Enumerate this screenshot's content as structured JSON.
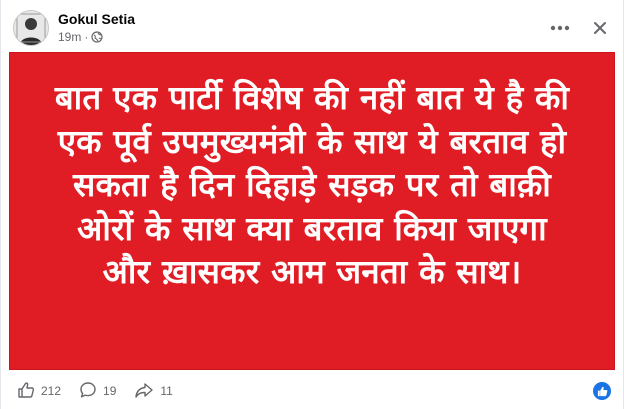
{
  "post": {
    "author": "Gokul Setia",
    "time": "19m",
    "separator": "·",
    "privacy_icon": "globe-icon"
  },
  "image_text": {
    "lines": [
      "बात एक पार्टी विशेष की नहीं बात ये है की",
      "एक पूर्व उपमुख्यमंत्री के साथ ये बरताव हो",
      "सकता है दिन दिहाड़े सड़क पर तो बाक़ी",
      "ओरों के साथ क्या बरताव किया जाएगा",
      "और ख़ासकर आम जनता के साथ।"
    ],
    "background_color": "#e01d24",
    "text_color": "#ffffff"
  },
  "stats": {
    "likes": "212",
    "comments": "19",
    "shares": "11"
  },
  "icons": {
    "more": "more-options-icon",
    "close": "close-icon",
    "like": "thumbs-up-icon",
    "comment": "comment-icon",
    "share": "share-icon",
    "reaction": "like-reaction-icon"
  }
}
